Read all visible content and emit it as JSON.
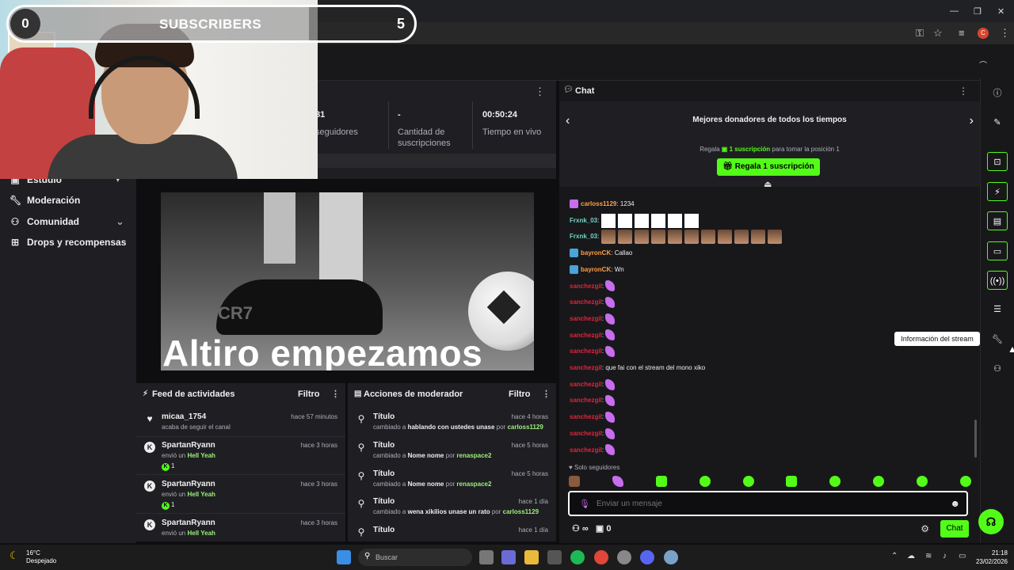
{
  "overlay": {
    "sub_start": "0",
    "sub_label": "SUBSCRIBERS",
    "sub_goal": "5",
    "progress_fraction": 0.0
  },
  "stats": {
    "followers_value": "81",
    "followers_label": "seguidores",
    "subs_value": "-",
    "subs_label_1": "Cantidad de",
    "subs_label_2": "suscripciones",
    "live_value": "00:50:24",
    "live_label": "Tiempo en vivo"
  },
  "nav": {
    "studio": "Estudio",
    "moderation": "Moderación",
    "community": "Comunidad",
    "drops": "Drops y recompensas"
  },
  "video": {
    "caption": "Altiro empezamos",
    "brand": "CR7"
  },
  "activity": {
    "title": "Feed de actividades",
    "filter": "Filtro",
    "items": [
      {
        "name": "micaa_1754",
        "time": "hace 57 minutos",
        "desc": "acaba de seguir el canal"
      },
      {
        "name": "SpartanRyann",
        "time": "hace 3 horas",
        "desc_pre": "envió un",
        "gift": "Hell Yeah",
        "count": "1"
      },
      {
        "name": "SpartanRyann",
        "time": "hace 3 horas",
        "desc_pre": "envió un",
        "gift": "Hell Yeah",
        "count": "1"
      },
      {
        "name": "SpartanRyann",
        "time": "hace 3 horas",
        "desc_pre": "envió un",
        "gift": "Hell Yeah"
      }
    ]
  },
  "modactions": {
    "title": "Acciones de moderador",
    "filter": "Filtro",
    "items": [
      {
        "title": "Título",
        "time": "hace 4 horas",
        "pre": "cambiado a",
        "value": "hablando con ustedes unase",
        "by": "por",
        "mod": "carloss1129"
      },
      {
        "title": "Título",
        "time": "hace 5 horas",
        "pre": "cambiado a",
        "value": "Nome nome",
        "by": "por",
        "mod": "renaspace2"
      },
      {
        "title": "Título",
        "time": "hace 5 horas",
        "pre": "cambiado a",
        "value": "Nome nome",
        "by": "por",
        "mod": "renaspace2"
      },
      {
        "title": "Título",
        "time": "hace 1 día",
        "pre": "cambiado a",
        "value": "wena xikilios unase un rato",
        "by": "por",
        "mod": "carloss1129"
      },
      {
        "title": "Título",
        "time": "hace 1 día"
      }
    ]
  },
  "chat": {
    "title": "Chat",
    "donors_title": "Mejores donadores de todos los tiempos",
    "hint_pre": "Regala",
    "hint_link": "1 suscripción",
    "hint_post": "para tomar la posición 1",
    "gift_button": "Regala 1 suscripción",
    "messages": [
      {
        "user": "carloss1129",
        "color": "#ff9f43",
        "text": "1234"
      },
      {
        "user": "Frxnk_03",
        "color": "#6fd6c4",
        "kind": "boxes"
      },
      {
        "user": "Frxnk_03",
        "color": "#6fd6c4",
        "kind": "faces"
      },
      {
        "user": "bayronCK",
        "color": "#ff9f43",
        "text": "Callao"
      },
      {
        "user": "bayronCK",
        "color": "#ff9f43",
        "text": "Wn"
      },
      {
        "user": "sanchezgil",
        "color": "#e0243a",
        "kind": "feather"
      },
      {
        "user": "sanchezgil",
        "color": "#e0243a",
        "kind": "feather"
      },
      {
        "user": "sanchezgil",
        "color": "#e0243a",
        "kind": "feather"
      },
      {
        "user": "sanchezgil",
        "color": "#e0243a",
        "kind": "feather"
      },
      {
        "user": "sanchezgil",
        "color": "#e0243a",
        "kind": "feather"
      },
      {
        "user": "sanchezgil",
        "color": "#e0243a",
        "text": "que fai con el stream del mono xiko"
      },
      {
        "user": "sanchezgil",
        "color": "#e0243a",
        "kind": "feather"
      },
      {
        "user": "sanchezgil",
        "color": "#e0243a",
        "kind": "feather"
      },
      {
        "user": "sanchezgil",
        "color": "#e0243a",
        "kind": "feather"
      },
      {
        "user": "sanchezgil",
        "color": "#e0243a",
        "kind": "feather"
      },
      {
        "user": "sanchezgil",
        "color": "#e0243a",
        "kind": "feather"
      }
    ],
    "followers_only": "Solo seguidores",
    "input_placeholder": "Enviar un mensaje",
    "counter": "0",
    "send": "Chat"
  },
  "rail": {
    "tooltip": "Información del stream"
  },
  "taskbar": {
    "temp": "16°C",
    "weather": "Despejado",
    "search": "Buscar",
    "time": "21:18",
    "date": "23/02/2026"
  },
  "colors": {
    "accent": "#53fc18",
    "bg": "#0e0e10",
    "panel": "#1f1f23"
  }
}
